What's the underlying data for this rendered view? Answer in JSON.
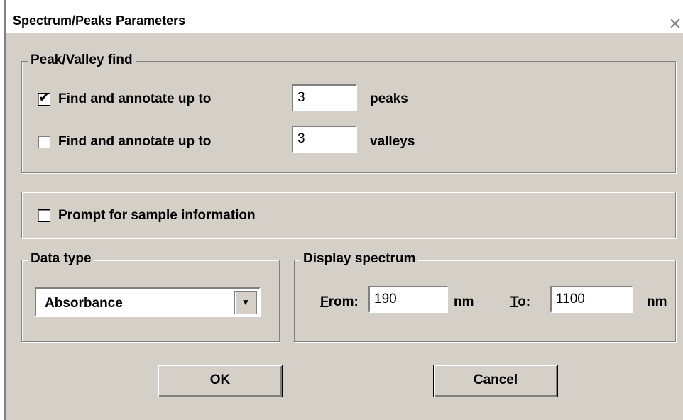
{
  "dialog": {
    "title": "Spectrum/Peaks Parameters",
    "close_icon": "close-icon"
  },
  "peak_valley": {
    "legend": "Peak/Valley find",
    "peaks": {
      "checked": true,
      "label": "Find and annotate up to",
      "value": "3",
      "unit": "peaks"
    },
    "valleys": {
      "checked": false,
      "label": "Find and annotate up to",
      "value": "3",
      "unit": "valleys"
    }
  },
  "prompt": {
    "checked": false,
    "label": "Prompt for sample information"
  },
  "data_type": {
    "legend": "Data type",
    "selected": "Absorbance"
  },
  "display_spectrum": {
    "legend": "Display spectrum",
    "from_label": "From:",
    "from_value": "190",
    "from_unit": "nm",
    "to_label": "To:",
    "to_value": "1100",
    "to_unit": "nm"
  },
  "buttons": {
    "ok": "OK",
    "cancel": "Cancel"
  }
}
